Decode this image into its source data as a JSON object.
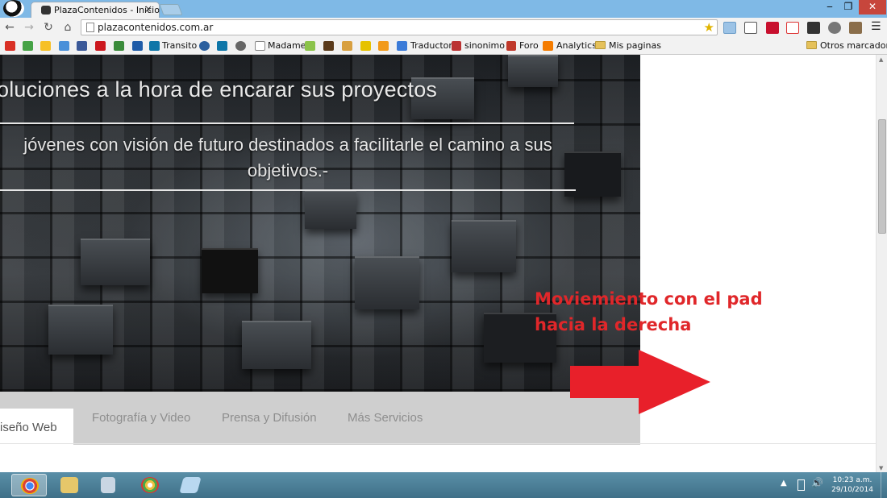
{
  "browser": {
    "tab_title": "PlazaContenidos - Inicio",
    "tab_close": "×",
    "url": "plazacontenidos.com.ar",
    "window_buttons": {
      "minimize": "‒",
      "maximize": "❐",
      "close": "✕"
    },
    "nav": {
      "back": "←",
      "forward": "→",
      "reload": "↻",
      "home": "⌂"
    },
    "star": "★"
  },
  "bookmarks": {
    "items": [
      {
        "label": "Transito"
      },
      {
        "label": "Madame"
      },
      {
        "label": "Traductor"
      },
      {
        "label": "sinonimo"
      },
      {
        "label": "Foro"
      },
      {
        "label": "Analytics"
      },
      {
        "label": "Mis paginas"
      }
    ],
    "other": "Otros marcadores"
  },
  "hero": {
    "subtitle": "oluciones a la hora de encarar sus proyectos",
    "text": "jóvenes con visión de futuro destinados a facilitarle el camino a sus objetivos.-"
  },
  "menu": {
    "items": [
      "iseño Web",
      "Fotografía y Video",
      "Prensa y Difusión",
      "Más Servicios"
    ]
  },
  "annotation": {
    "line1": "Moviemiento con el pad",
    "line2": "hacia la derecha",
    "color": "#e0272a"
  },
  "taskbar": {
    "time": "10:23 a.m.",
    "date": "29/10/2014"
  }
}
